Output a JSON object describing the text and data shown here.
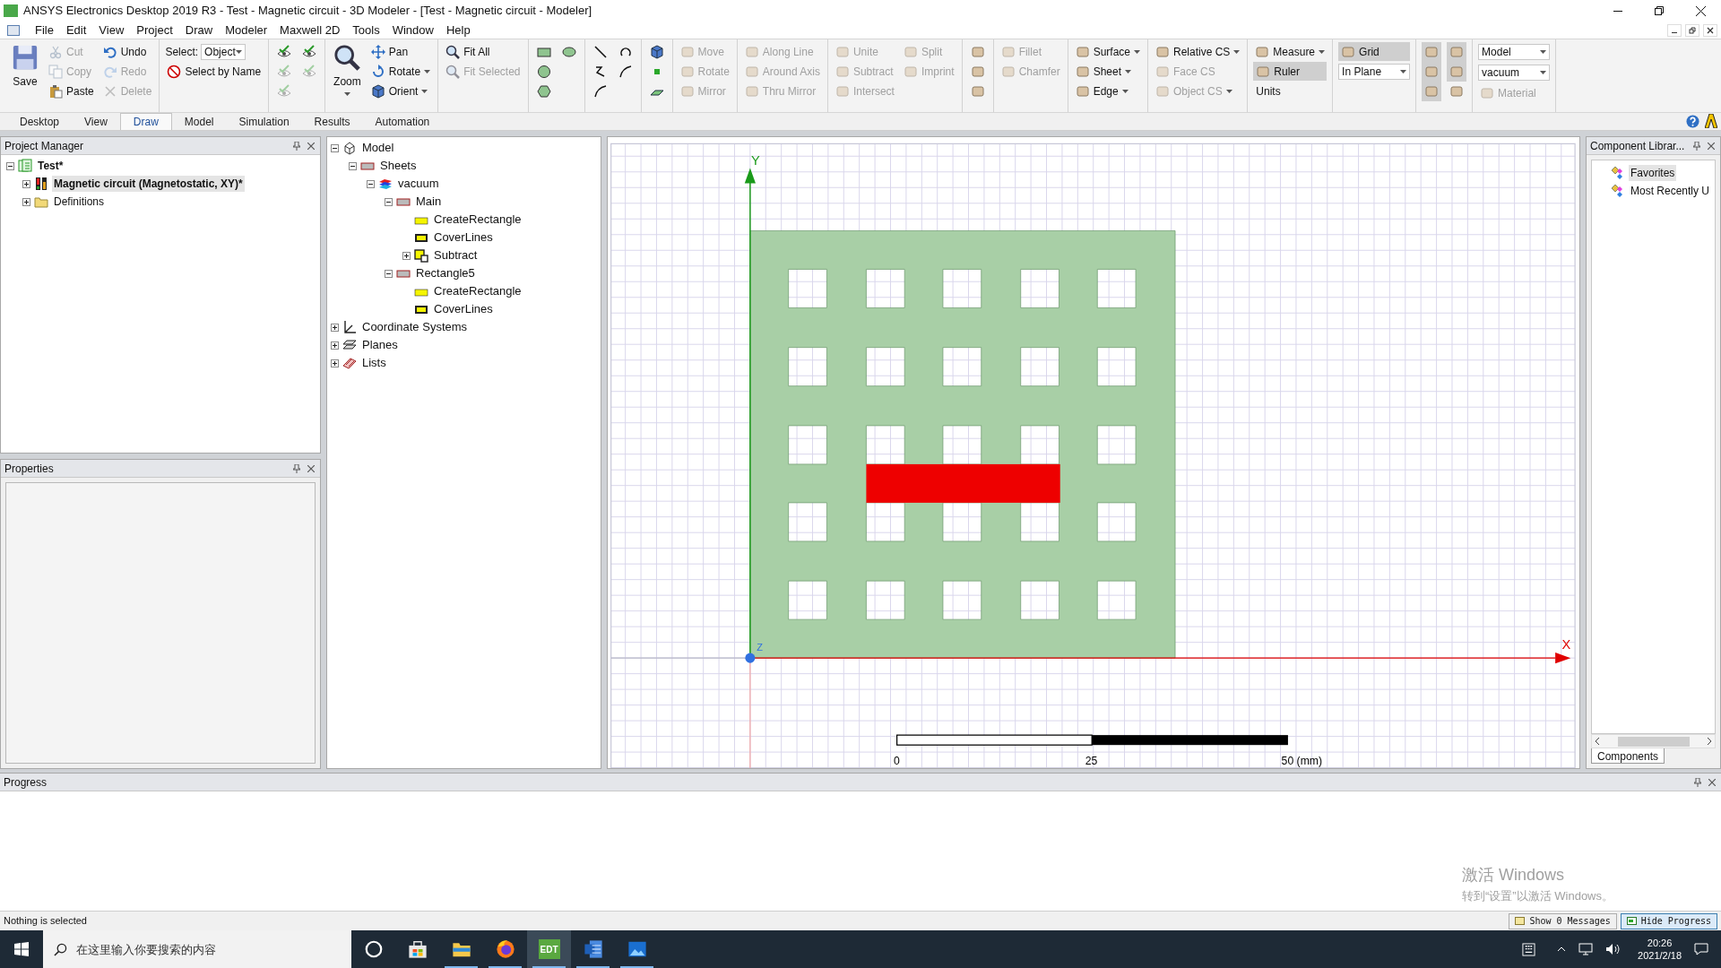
{
  "window": {
    "title": "ANSYS Electronics Desktop 2019 R3 - Test - Magnetic circuit - 3D Modeler - [Test - Magnetic circuit - Modeler]"
  },
  "menu": [
    "File",
    "Edit",
    "View",
    "Project",
    "Draw",
    "Modeler",
    "Maxwell 2D",
    "Tools",
    "Window",
    "Help"
  ],
  "ribbon": [
    {
      "columns": [
        {
          "kind": "large",
          "label": "Save",
          "disabled": false,
          "dropdown": false
        },
        {
          "kind": "buttons",
          "items": [
            {
              "label": "Cut",
              "disabled": true
            },
            {
              "label": "Copy",
              "disabled": true
            },
            {
              "label": "Paste",
              "disabled": false
            }
          ]
        },
        {
          "kind": "buttons",
          "items": [
            {
              "label": "Undo",
              "disabled": false
            },
            {
              "label": "Redo",
              "disabled": true
            },
            {
              "label": "Delete",
              "disabled": true
            }
          ]
        }
      ]
    },
    {
      "columns": [
        {
          "kind": "select",
          "label": "Select:",
          "value": "Object",
          "items": [
            {
              "label": "Select by Name",
              "disabled": false
            }
          ]
        }
      ]
    },
    {
      "columns": [
        {
          "kind": "icons",
          "items": [
            {
              "disabled": false
            },
            {
              "disabled": true
            },
            {
              "disabled": true
            }
          ]
        },
        {
          "kind": "icons",
          "items": [
            {
              "disabled": false
            },
            {
              "disabled": true
            }
          ]
        }
      ]
    },
    {
      "columns": [
        {
          "kind": "large",
          "label": "Zoom",
          "disabled": false,
          "dropdown": true
        },
        {
          "kind": "buttons",
          "items": [
            {
              "label": "Pan",
              "disabled": false,
              "dropdown": false
            },
            {
              "label": "Rotate",
              "disabled": false,
              "dropdown": true
            },
            {
              "label": "Orient",
              "disabled": false,
              "dropdown": true
            }
          ]
        }
      ]
    },
    {
      "columns": [
        {
          "kind": "buttons",
          "items": [
            {
              "label": "Fit All",
              "disabled": false
            },
            {
              "label": "Fit Selected",
              "disabled": true
            }
          ]
        }
      ]
    },
    {
      "columns": [
        {
          "kind": "icons",
          "items": [
            {
              "disabled": false
            },
            {
              "disabled": false
            },
            {
              "disabled": false
            }
          ]
        },
        {
          "kind": "icons",
          "items": [
            {
              "disabled": false
            }
          ]
        }
      ]
    },
    {
      "columns": [
        {
          "kind": "icons",
          "items": [
            {
              "disabled": false
            },
            {
              "disabled": false
            },
            {
              "disabled": false
            }
          ]
        },
        {
          "kind": "icons",
          "items": [
            {
              "disabled": false
            },
            {
              "disabled": false
            }
          ]
        }
      ]
    },
    {
      "columns": [
        {
          "kind": "icons",
          "items": [
            {
              "disabled": false
            },
            {
              "disabled": false
            },
            {
              "disabled": false
            }
          ]
        }
      ]
    },
    {
      "columns": [
        {
          "kind": "buttons",
          "items": [
            {
              "label": "Move",
              "disabled": true
            },
            {
              "label": "Rotate",
              "disabled": true
            },
            {
              "label": "Mirror",
              "disabled": true
            }
          ]
        }
      ]
    },
    {
      "columns": [
        {
          "kind": "buttons",
          "items": [
            {
              "label": "Along Line",
              "disabled": true
            },
            {
              "label": "Around Axis",
              "disabled": true
            },
            {
              "label": "Thru Mirror",
              "disabled": true
            }
          ]
        }
      ]
    },
    {
      "columns": [
        {
          "kind": "buttons",
          "items": [
            {
              "label": "Unite",
              "disabled": true
            },
            {
              "label": "Subtract",
              "disabled": true
            },
            {
              "label": "Intersect",
              "disabled": true
            }
          ]
        },
        {
          "kind": "buttons",
          "items": [
            {
              "label": "Split",
              "disabled": true
            },
            {
              "label": "Imprint",
              "disabled": true
            }
          ]
        }
      ]
    },
    {
      "columns": [
        {
          "kind": "icons",
          "items": [
            {
              "disabled": false
            },
            {
              "disabled": false
            },
            {
              "disabled": false
            }
          ]
        }
      ]
    },
    {
      "columns": [
        {
          "kind": "buttons",
          "items": [
            {
              "label": "Fillet",
              "disabled": true
            },
            {
              "label": "Chamfer",
              "disabled": true
            }
          ]
        }
      ]
    },
    {
      "columns": [
        {
          "kind": "buttons",
          "items": [
            {
              "label": "Surface",
              "disabled": false,
              "dropdown": true
            },
            {
              "label": "Sheet",
              "disabled": false,
              "dropdown": true
            },
            {
              "label": "Edge",
              "disabled": false,
              "dropdown": true
            }
          ]
        }
      ]
    },
    {
      "columns": [
        {
          "kind": "buttons",
          "items": [
            {
              "label": "Relative CS",
              "disabled": false,
              "dropdown": true
            },
            {
              "label": "Face CS",
              "disabled": true,
              "dropdown": false
            },
            {
              "label": "Object CS",
              "disabled": true,
              "dropdown": true
            }
          ]
        }
      ]
    },
    {
      "columns": [
        {
          "kind": "controls",
          "items": [
            {
              "kind": "button",
              "label": "Measure",
              "dropdown": true
            },
            {
              "kind": "toggle",
              "label": "Ruler",
              "on": true
            },
            {
              "kind": "text",
              "label": "Units"
            }
          ]
        }
      ]
    },
    {
      "columns": [
        {
          "kind": "controls",
          "items": [
            {
              "kind": "toggle",
              "label": "Grid",
              "on": true
            },
            {
              "kind": "dropdown",
              "value": "In Plane"
            }
          ]
        }
      ]
    },
    {
      "columns": [
        {
          "kind": "icons",
          "items": [
            {
              "on": true
            },
            {
              "on": true
            },
            {
              "on": true
            }
          ]
        },
        {
          "kind": "icons",
          "items": [
            {
              "on": true
            },
            {
              "on": true
            },
            {
              "on": false
            }
          ]
        }
      ]
    },
    {
      "columns": [
        {
          "kind": "controls",
          "items": [
            {
              "kind": "dropdown",
              "value": "Model"
            },
            {
              "kind": "dropdown",
              "value": "vacuum"
            },
            {
              "kind": "button",
              "label": "Material",
              "disabled": true
            }
          ]
        }
      ]
    }
  ],
  "ribbon_tabs": [
    {
      "label": "Desktop",
      "selected": false
    },
    {
      "label": "View",
      "selected": false
    },
    {
      "label": "Draw",
      "selected": true
    },
    {
      "label": "Model",
      "selected": false
    },
    {
      "label": "Simulation",
      "selected": false
    },
    {
      "label": "Results",
      "selected": false
    },
    {
      "label": "Automation",
      "selected": false
    }
  ],
  "project_manager": {
    "title": "Project Manager",
    "tree": [
      {
        "label": "Test*",
        "kind": "project",
        "bold": true,
        "selected": false,
        "expanded": true,
        "children": [
          {
            "label": "Magnetic circuit (Magnetostatic, XY)*",
            "kind": "design",
            "bold": true,
            "selected": true,
            "expanded": false
          },
          {
            "label": "Definitions",
            "kind": "folder",
            "bold": false,
            "selected": false,
            "expanded": false
          }
        ]
      }
    ]
  },
  "properties": {
    "title": "Properties"
  },
  "model_tree": [
    {
      "label": "Model",
      "kind": "model",
      "selected": false,
      "expanded": true,
      "children": [
        {
          "label": "Sheets",
          "kind": "group",
          "selected": false,
          "expanded": true,
          "children": [
            {
              "label": "vacuum",
              "kind": "material",
              "selected": false,
              "expanded": true,
              "children": [
                {
                  "label": "Main",
                  "kind": "group",
                  "selected": false,
                  "expanded": true,
                  "children": [
                    {
                      "label": "CreateRectangle",
                      "kind": "operation",
                      "selected": false
                    },
                    {
                      "label": "CoverLines",
                      "kind": "cover",
                      "selected": false
                    },
                    {
                      "label": "Subtract",
                      "kind": "subtract",
                      "selected": false,
                      "expanded": false
                    }
                  ]
                },
                {
                  "label": "Rectangle5",
                  "kind": "group",
                  "selected": false,
                  "expanded": true,
                  "children": [
                    {
                      "label": "CreateRectangle",
                      "kind": "operation",
                      "selected": false
                    },
                    {
                      "label": "CoverLines",
                      "kind": "cover",
                      "selected": false
                    }
                  ]
                }
              ]
            }
          ]
        }
      ]
    },
    {
      "label": "Coordinate Systems",
      "kind": "cs",
      "selected": false,
      "expanded": false
    },
    {
      "label": "Planes",
      "kind": "planes",
      "selected": false,
      "expanded": false
    },
    {
      "label": "Lists",
      "kind": "lists",
      "selected": false,
      "expanded": false
    }
  ],
  "canvas": {
    "axes": {
      "x": "X",
      "y": "Y",
      "z": "Z"
    },
    "scale_labels": [
      "0",
      "25",
      "50 (mm)"
    ]
  },
  "component_library": {
    "title": "Component Librar...",
    "tree": [
      {
        "label": "Favorites",
        "selected": true
      },
      {
        "label": "Most Recently U",
        "selected": false
      }
    ],
    "tab": "Components"
  },
  "progress": {
    "title": "Progress"
  },
  "windows_notice": {
    "title": "激活 Windows",
    "text": "转到“设置”以激活 Windows。"
  },
  "status_bar": {
    "text": "Nothing is selected",
    "buttons": [
      {
        "label": "Show 0 Messages",
        "selected": false
      },
      {
        "label": "Hide Progress",
        "selected": true
      }
    ]
  },
  "taskbar": {
    "search_placeholder": "在这里输入你要搜索的内容",
    "apps": [
      {
        "kind": "cortana",
        "running": false,
        "active": false
      },
      {
        "kind": "store",
        "running": false,
        "active": false
      },
      {
        "kind": "explorer",
        "running": true,
        "active": false
      },
      {
        "kind": "firefox",
        "running": true,
        "active": false
      },
      {
        "kind": "edt",
        "label": "EDT",
        "running": true,
        "active": true
      },
      {
        "kind": "word",
        "running": true,
        "active": false
      },
      {
        "kind": "photos",
        "running": true,
        "active": false
      }
    ],
    "time": "20:26",
    "date": "2021/2/18"
  }
}
